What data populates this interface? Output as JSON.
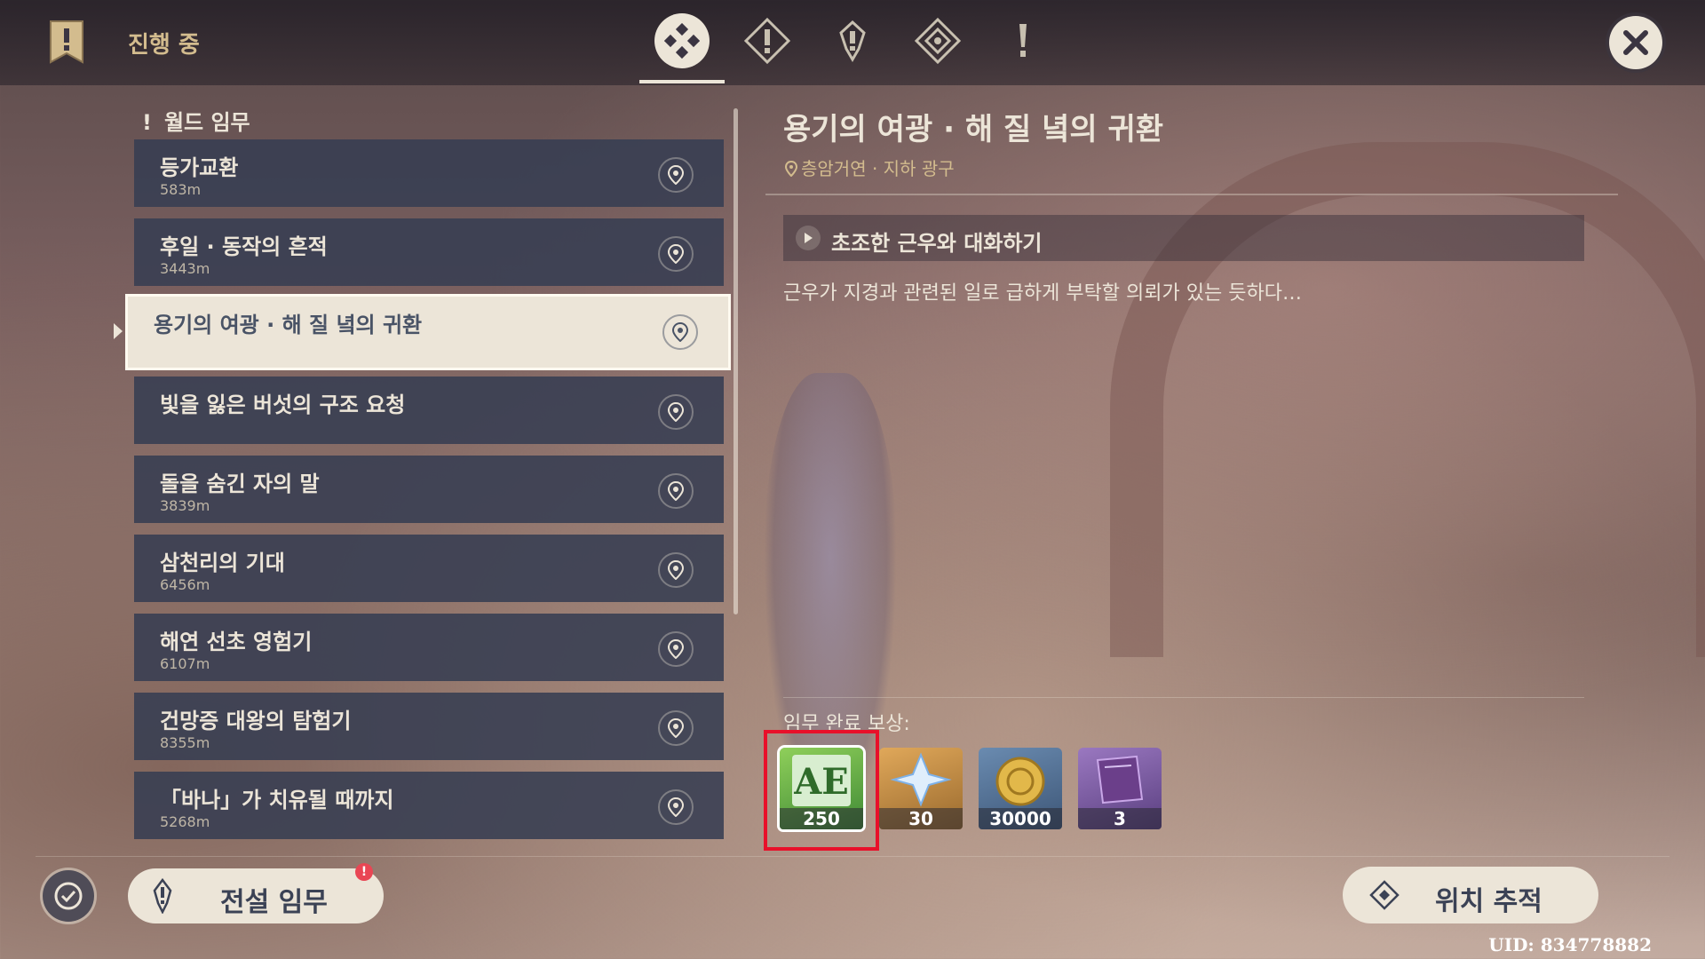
{
  "header": {
    "title": "진행 중",
    "tabs": [
      {
        "name": "all",
        "active": true
      },
      {
        "name": "archon",
        "active": false
      },
      {
        "name": "story",
        "active": false
      },
      {
        "name": "commission",
        "active": false
      },
      {
        "name": "world",
        "active": false
      }
    ]
  },
  "quest_list": {
    "category": "월드 임무",
    "items": [
      {
        "name": "등가교환",
        "distance": "583m"
      },
      {
        "name": "후일 · 동작의 흔적",
        "distance": "3443m"
      },
      {
        "name": "용기의 여광 · 해 질 녘의 귀환",
        "distance": "",
        "selected": true
      },
      {
        "name": "빛을 잃은 버섯의 구조 요청",
        "distance": ""
      },
      {
        "name": "돌을 숨긴 자의 말",
        "distance": "3839m"
      },
      {
        "name": "삼천리의 기대",
        "distance": "6456m"
      },
      {
        "name": "해연 선초 영험기",
        "distance": "6107m"
      },
      {
        "name": "건망증 대왕의 탐험기",
        "distance": "8355m"
      },
      {
        "name": "「바나」가 치유될 때까지",
        "distance": "5268m"
      }
    ]
  },
  "detail": {
    "title": "용기의 여광 · 해 질 녘의 귀환",
    "location": "층암거연 · 지하 광구",
    "objective": "초조한 근우와 대화하기",
    "description": "근우가 지경과 관련된 일로 급하게 부탁할 의뢰가 있는 듯하다…",
    "reward_label": "임무 완료 보상:",
    "rewards": [
      {
        "item": "adventure-exp-icon",
        "count": "250",
        "color": "#6cab3c"
      },
      {
        "item": "primogem-icon",
        "count": "30",
        "color": "#c48a3a"
      },
      {
        "item": "mora-icon",
        "count": "30000",
        "color": "#4f6b8a"
      },
      {
        "item": "book-icon",
        "count": "3",
        "color": "#7a5a9a"
      }
    ]
  },
  "footer": {
    "legend_button": "전설 임무",
    "legend_badge": "!",
    "track_button": "위치 추적",
    "uid": "UID: 834778882"
  }
}
